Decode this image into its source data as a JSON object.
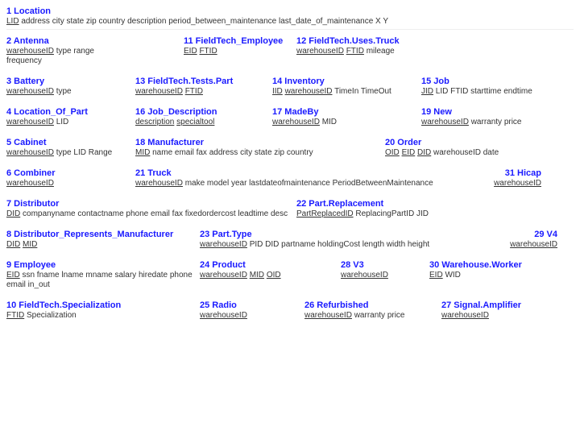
{
  "sections": [
    {
      "id": "location1",
      "number": "1",
      "title": "Location",
      "attrs": "LID address city state zip country description period_between_maintenance last_date_of_maintenance X Y",
      "underlined": [
        "LID"
      ]
    },
    {
      "id": "antenna",
      "number": "2",
      "title": "Antenna",
      "attrs": "warehouseID type range frequency",
      "underlined": [
        "warehouseID"
      ]
    },
    {
      "id": "fieldtech_employee",
      "number": "11",
      "title": "FieldTech_Employee",
      "attrs": "EID FTID",
      "underlined": [
        "EID",
        "FTID"
      ]
    },
    {
      "id": "fieldtech_uses_truck",
      "number": "12",
      "title": "FieldTech.Uses.Truck",
      "attrs": "warehouseID FTID mileage",
      "underlined": [
        "warehouseID",
        "FTID"
      ]
    },
    {
      "id": "battery",
      "number": "3",
      "title": "Battery",
      "attrs": "warehouseID type",
      "underlined": [
        "warehouseID"
      ]
    },
    {
      "id": "fieldtech_tests_part",
      "number": "13",
      "title": "FieldTech.Tests.Part",
      "attrs": "warehouseID FTID",
      "underlined": [
        "warehouseID",
        "FTID"
      ]
    },
    {
      "id": "inventory",
      "number": "14",
      "title": "Inventory",
      "attrs": "IID warehouseID TimeIn TimeOut",
      "underlined": [
        "IID",
        "warehouseID"
      ]
    },
    {
      "id": "job",
      "number": "15",
      "title": "Job",
      "attrs": "JID LID FTID starttime endtime",
      "underlined": [
        "JID"
      ]
    },
    {
      "id": "location_of_part",
      "number": "4",
      "title": "Location_Of_Part",
      "attrs": "warehouseID LID",
      "underlined": [
        "warehouseID"
      ]
    },
    {
      "id": "job_description",
      "number": "16",
      "title": "Job_Description",
      "attrs": "description specialtool",
      "underlined": [
        "description",
        "specialtool"
      ]
    },
    {
      "id": "madeby",
      "number": "17",
      "title": "MadeBy",
      "attrs": "warehouseID MID",
      "underlined": [
        "warehouseID"
      ]
    },
    {
      "id": "new",
      "number": "19",
      "title": "New",
      "attrs": "warehouseID warranty price",
      "underlined": [
        "warehouseID"
      ]
    },
    {
      "id": "cabinet",
      "number": "5",
      "title": "Cabinet",
      "attrs": "warehouseID type LID Range",
      "underlined": [
        "warehouseID"
      ]
    },
    {
      "id": "manufacturer",
      "number": "18",
      "title": "Manufacturer",
      "attrs": "MID name email fax address city state zip country",
      "underlined": [
        "MID"
      ]
    },
    {
      "id": "order",
      "number": "20",
      "title": "Order",
      "attrs": "OID EID DID warehouseID date",
      "underlined": [
        "OID",
        "EID",
        "DID"
      ]
    },
    {
      "id": "combiner",
      "number": "6",
      "title": "Combiner",
      "attrs": "warehouseID",
      "underlined": [
        "warehouseID"
      ]
    },
    {
      "id": "truck",
      "number": "21",
      "title": "Truck",
      "attrs": "warehouseID make model year lastdateofmaintenance PeriodBetweenMaintenance",
      "underlined": [
        "warehouseID"
      ]
    },
    {
      "id": "hicap",
      "number": "31",
      "title": "Hicap",
      "attrs": "warehouseID",
      "underlined": [
        "warehouseID"
      ]
    },
    {
      "id": "distributor",
      "number": "7",
      "title": "Distributor",
      "attrs": "DID companyname contactname phone email fax fixedordercost leadtime desc",
      "underlined": [
        "DID"
      ]
    },
    {
      "id": "part_replacement",
      "number": "22",
      "title": "Part.Replacement",
      "attrs": "PartReplacedID ReplacingPartID JID",
      "underlined": [
        "PartReplacedID"
      ]
    },
    {
      "id": "distributor_represents_manufacturer",
      "number": "8",
      "title": "Distributor_Represents_Manufacturer",
      "attrs": "DID MID",
      "underlined": [
        "DID",
        "MID"
      ]
    },
    {
      "id": "part_type",
      "number": "23",
      "title": "Part.Type",
      "attrs": "warehouseID PID DID partname holdingCost length width height",
      "underlined": [
        "warehouseID"
      ]
    },
    {
      "id": "v4",
      "number": "29",
      "title": "V4",
      "attrs": "warehouseID",
      "underlined": [
        "warehouseID"
      ]
    },
    {
      "id": "employee",
      "number": "9",
      "title": "Employee",
      "attrs": "EID ssn fname lname mname salary hiredate phone email in_out",
      "underlined": [
        "EID"
      ]
    },
    {
      "id": "product",
      "number": "24",
      "title": "Product",
      "attrs": "warehouseID MID OID",
      "underlined": [
        "warehouseID",
        "MID",
        "OID"
      ]
    },
    {
      "id": "v3",
      "number": "28",
      "title": "V3",
      "attrs": "warehouseID",
      "underlined": [
        "warehouseID"
      ]
    },
    {
      "id": "warehouse_worker",
      "number": "30",
      "title": "Warehouse.Worker",
      "attrs": "EID WID",
      "underlined": [
        "EID"
      ]
    },
    {
      "id": "fieldtech_specialization",
      "number": "10",
      "title": "FieldTech.Specialization",
      "attrs": "FTID Specialization",
      "underlined": [
        "FTID"
      ]
    },
    {
      "id": "radio",
      "number": "25",
      "title": "Radio",
      "attrs": "warehouseID",
      "underlined": [
        "warehouseID"
      ]
    },
    {
      "id": "refurbished",
      "number": "26",
      "title": "Refurbished",
      "attrs": "warehouseID warranty price",
      "underlined": [
        "warehouseID"
      ]
    },
    {
      "id": "signal_amplifier",
      "number": "27",
      "title": "Signal.Amplifier",
      "attrs": "warehouseID",
      "underlined": [
        "warehouseID"
      ]
    }
  ]
}
